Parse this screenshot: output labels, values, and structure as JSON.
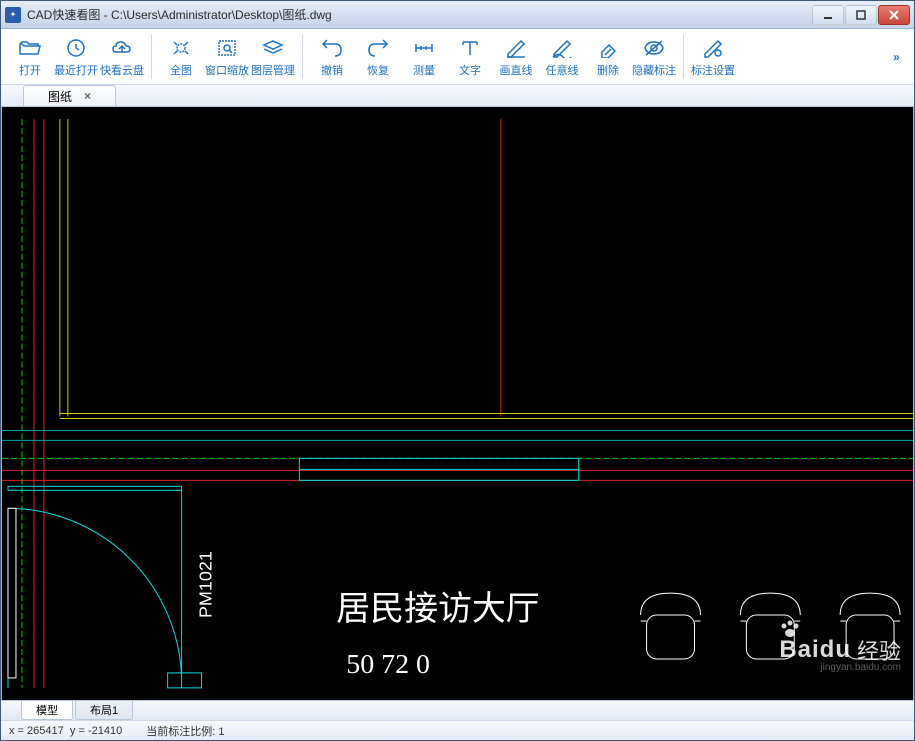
{
  "window": {
    "title": "CAD快速看图 - C:\\Users\\Administrator\\Desktop\\图纸.dwg"
  },
  "toolbar": {
    "open": "打开",
    "recent": "最近打开",
    "cloud": "快看云盘",
    "full": "全图",
    "zoomwin": "窗口缩放",
    "layers": "图层管理",
    "undo": "撤销",
    "redo": "恢复",
    "measure": "测量",
    "text": "文字",
    "line": "画直线",
    "polyline": "任意线",
    "delete": "删除",
    "hidemark": "隐藏标注",
    "marksettings": "标注设置",
    "more": "»"
  },
  "tabs": {
    "doc": "图纸"
  },
  "drawing": {
    "room_label": "居民接访大厅",
    "door_tag": "PM1021"
  },
  "layouttabs": {
    "model": "模型",
    "layout1": "布局1"
  },
  "status": {
    "coords_label_x": "x =",
    "coords_x": "265417",
    "coords_label_y": "y =",
    "coords_y": "-21410",
    "scale_label": "当前标注比例:",
    "scale_value": "1"
  },
  "watermark": {
    "brand": "Baidu",
    "product": "经验",
    "url": "jingyan.baidu.com"
  }
}
